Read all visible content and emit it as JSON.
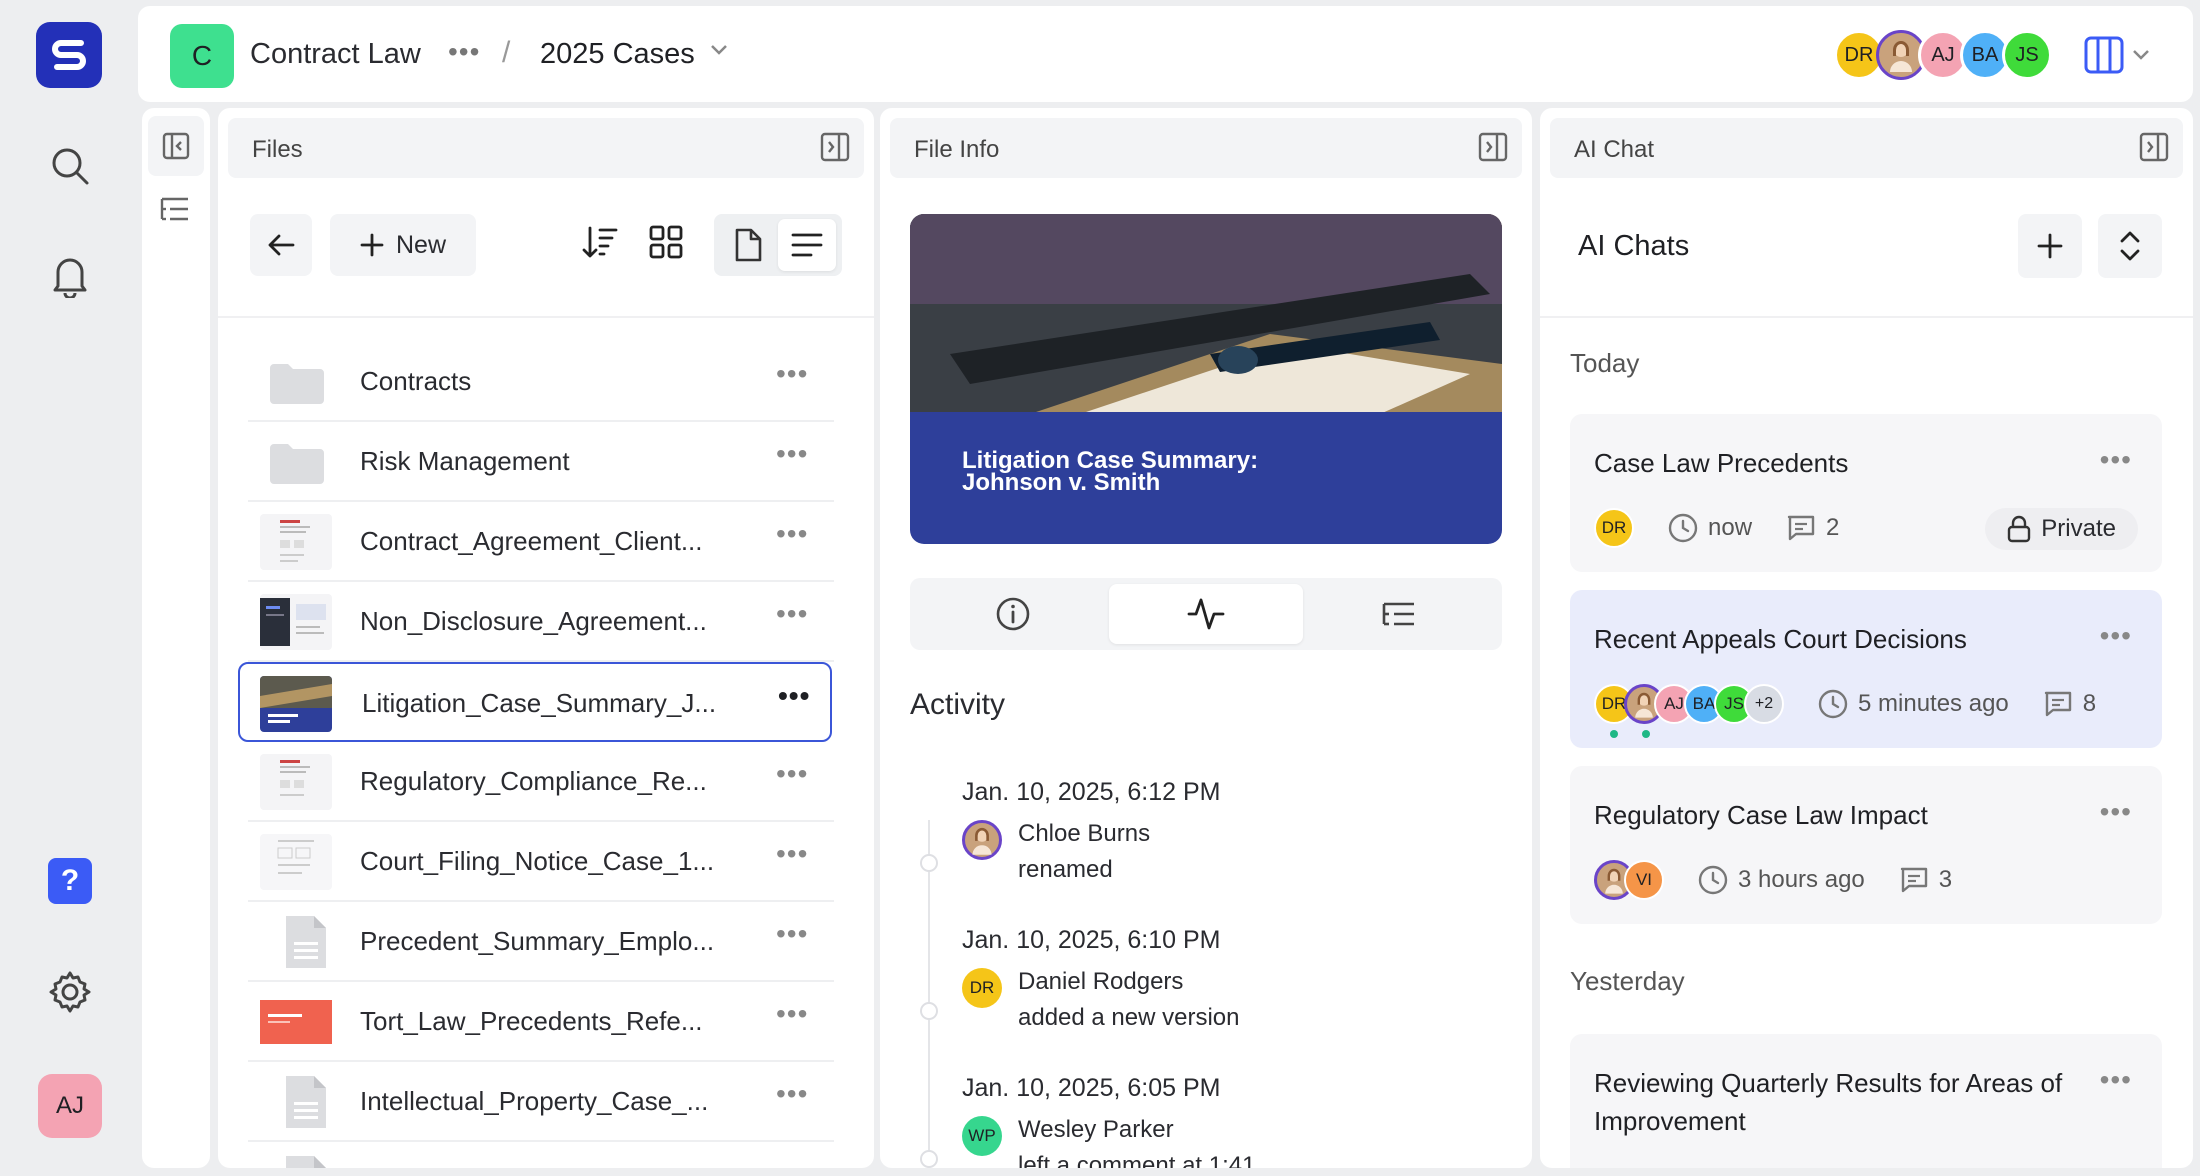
{
  "workspace": {
    "initial": "C",
    "name": "Contract Law",
    "more": "•••",
    "separator": "/",
    "folder": "2025 Cases"
  },
  "user": {
    "initials": "AJ"
  },
  "collaborators": [
    {
      "initials": "DR",
      "color": "#f5c518"
    },
    {
      "initials": "",
      "color": "#c9a27c"
    },
    {
      "initials": "AJ",
      "color": "#f4a3b3"
    },
    {
      "initials": "BA",
      "color": "#4fb0f7"
    },
    {
      "initials": "JS",
      "color": "#3fdb3a"
    }
  ],
  "panels": {
    "files": "Files",
    "info": "File Info",
    "chat": "AI Chat"
  },
  "files_toolbar": {
    "new_label": "New"
  },
  "files": [
    {
      "name": "Contracts",
      "kind": "folder"
    },
    {
      "name": "Risk Management",
      "kind": "folder"
    },
    {
      "name": "Contract_Agreement_Client...",
      "kind": "thumb-doc"
    },
    {
      "name": "Non_Disclosure_Agreement...",
      "kind": "thumb-dark"
    },
    {
      "name": "Litigation_Case_Summary_J...",
      "kind": "thumb-photo",
      "selected": true
    },
    {
      "name": "Regulatory_Compliance_Re...",
      "kind": "thumb-doc"
    },
    {
      "name": "Court_Filing_Notice_Case_1...",
      "kind": "thumb-form"
    },
    {
      "name": "Precedent_Summary_Emplo...",
      "kind": "doc"
    },
    {
      "name": "Tort_Law_Precedents_Refe...",
      "kind": "thumb-red"
    },
    {
      "name": "Intellectual_Property_Case_...",
      "kind": "doc"
    }
  ],
  "file_more": "•••",
  "preview": {
    "title": "Litigation Case Summary: Johnson v. Smith"
  },
  "activity": {
    "title": "Activity",
    "items": [
      {
        "date": "Jan. 10, 2025, 6:12 PM",
        "initials": "",
        "name": "Chloe Burns",
        "action": "renamed"
      },
      {
        "date": "Jan. 10, 2025, 6:10 PM",
        "initials": "DR",
        "name": "Daniel Rodgers",
        "action": "added a new version"
      },
      {
        "date": "Jan. 10, 2025, 6:05 PM",
        "initials": "WP",
        "name": "Wesley Parker",
        "action": "left a comment at 1:41"
      }
    ]
  },
  "chat": {
    "title": "AI Chats",
    "groups": {
      "today": "Today",
      "yesterday": "Yesterday"
    },
    "cards": [
      {
        "title": "Case Law Precedents",
        "avatars": [
          "DR"
        ],
        "time": "now",
        "count": "2",
        "private": "Private"
      },
      {
        "title": "Recent Appeals Court Decisions",
        "avatars": [
          "DR",
          "",
          "AJ",
          "BA",
          "JS"
        ],
        "extra": "+2",
        "time": "5 minutes ago",
        "count": "8"
      },
      {
        "title": "Regulatory Case Law Impact",
        "avatars": [
          "",
          "VI"
        ],
        "time": "3 hours ago",
        "count": "3"
      },
      {
        "title": "Reviewing Quarterly Results for Areas of Improvement"
      }
    ],
    "more": "•••"
  },
  "icons": [
    "logo-icon",
    "search-icon",
    "bell-icon",
    "help-icon",
    "gear-icon"
  ]
}
